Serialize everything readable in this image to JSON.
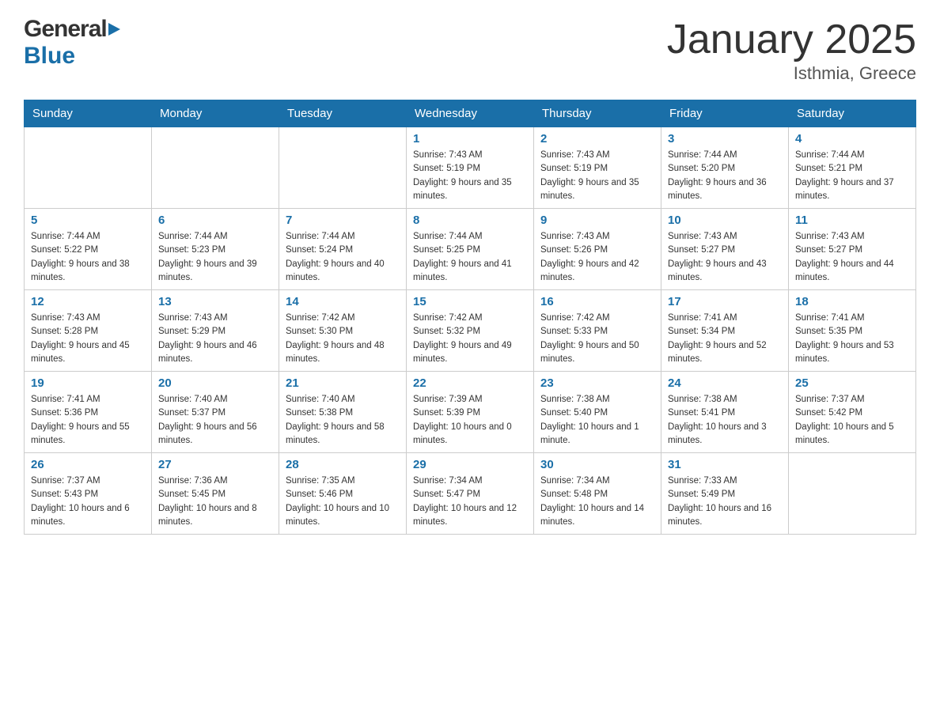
{
  "header": {
    "logo_general": "General",
    "logo_blue": "Blue",
    "title": "January 2025",
    "subtitle": "Isthmia, Greece"
  },
  "weekdays": [
    "Sunday",
    "Monday",
    "Tuesday",
    "Wednesday",
    "Thursday",
    "Friday",
    "Saturday"
  ],
  "weeks": [
    [
      {
        "day": "",
        "info": ""
      },
      {
        "day": "",
        "info": ""
      },
      {
        "day": "",
        "info": ""
      },
      {
        "day": "1",
        "info": "Sunrise: 7:43 AM\nSunset: 5:19 PM\nDaylight: 9 hours and 35 minutes."
      },
      {
        "day": "2",
        "info": "Sunrise: 7:43 AM\nSunset: 5:19 PM\nDaylight: 9 hours and 35 minutes."
      },
      {
        "day": "3",
        "info": "Sunrise: 7:44 AM\nSunset: 5:20 PM\nDaylight: 9 hours and 36 minutes."
      },
      {
        "day": "4",
        "info": "Sunrise: 7:44 AM\nSunset: 5:21 PM\nDaylight: 9 hours and 37 minutes."
      }
    ],
    [
      {
        "day": "5",
        "info": "Sunrise: 7:44 AM\nSunset: 5:22 PM\nDaylight: 9 hours and 38 minutes."
      },
      {
        "day": "6",
        "info": "Sunrise: 7:44 AM\nSunset: 5:23 PM\nDaylight: 9 hours and 39 minutes."
      },
      {
        "day": "7",
        "info": "Sunrise: 7:44 AM\nSunset: 5:24 PM\nDaylight: 9 hours and 40 minutes."
      },
      {
        "day": "8",
        "info": "Sunrise: 7:44 AM\nSunset: 5:25 PM\nDaylight: 9 hours and 41 minutes."
      },
      {
        "day": "9",
        "info": "Sunrise: 7:43 AM\nSunset: 5:26 PM\nDaylight: 9 hours and 42 minutes."
      },
      {
        "day": "10",
        "info": "Sunrise: 7:43 AM\nSunset: 5:27 PM\nDaylight: 9 hours and 43 minutes."
      },
      {
        "day": "11",
        "info": "Sunrise: 7:43 AM\nSunset: 5:27 PM\nDaylight: 9 hours and 44 minutes."
      }
    ],
    [
      {
        "day": "12",
        "info": "Sunrise: 7:43 AM\nSunset: 5:28 PM\nDaylight: 9 hours and 45 minutes."
      },
      {
        "day": "13",
        "info": "Sunrise: 7:43 AM\nSunset: 5:29 PM\nDaylight: 9 hours and 46 minutes."
      },
      {
        "day": "14",
        "info": "Sunrise: 7:42 AM\nSunset: 5:30 PM\nDaylight: 9 hours and 48 minutes."
      },
      {
        "day": "15",
        "info": "Sunrise: 7:42 AM\nSunset: 5:32 PM\nDaylight: 9 hours and 49 minutes."
      },
      {
        "day": "16",
        "info": "Sunrise: 7:42 AM\nSunset: 5:33 PM\nDaylight: 9 hours and 50 minutes."
      },
      {
        "day": "17",
        "info": "Sunrise: 7:41 AM\nSunset: 5:34 PM\nDaylight: 9 hours and 52 minutes."
      },
      {
        "day": "18",
        "info": "Sunrise: 7:41 AM\nSunset: 5:35 PM\nDaylight: 9 hours and 53 minutes."
      }
    ],
    [
      {
        "day": "19",
        "info": "Sunrise: 7:41 AM\nSunset: 5:36 PM\nDaylight: 9 hours and 55 minutes."
      },
      {
        "day": "20",
        "info": "Sunrise: 7:40 AM\nSunset: 5:37 PM\nDaylight: 9 hours and 56 minutes."
      },
      {
        "day": "21",
        "info": "Sunrise: 7:40 AM\nSunset: 5:38 PM\nDaylight: 9 hours and 58 minutes."
      },
      {
        "day": "22",
        "info": "Sunrise: 7:39 AM\nSunset: 5:39 PM\nDaylight: 10 hours and 0 minutes."
      },
      {
        "day": "23",
        "info": "Sunrise: 7:38 AM\nSunset: 5:40 PM\nDaylight: 10 hours and 1 minute."
      },
      {
        "day": "24",
        "info": "Sunrise: 7:38 AM\nSunset: 5:41 PM\nDaylight: 10 hours and 3 minutes."
      },
      {
        "day": "25",
        "info": "Sunrise: 7:37 AM\nSunset: 5:42 PM\nDaylight: 10 hours and 5 minutes."
      }
    ],
    [
      {
        "day": "26",
        "info": "Sunrise: 7:37 AM\nSunset: 5:43 PM\nDaylight: 10 hours and 6 minutes."
      },
      {
        "day": "27",
        "info": "Sunrise: 7:36 AM\nSunset: 5:45 PM\nDaylight: 10 hours and 8 minutes."
      },
      {
        "day": "28",
        "info": "Sunrise: 7:35 AM\nSunset: 5:46 PM\nDaylight: 10 hours and 10 minutes."
      },
      {
        "day": "29",
        "info": "Sunrise: 7:34 AM\nSunset: 5:47 PM\nDaylight: 10 hours and 12 minutes."
      },
      {
        "day": "30",
        "info": "Sunrise: 7:34 AM\nSunset: 5:48 PM\nDaylight: 10 hours and 14 minutes."
      },
      {
        "day": "31",
        "info": "Sunrise: 7:33 AM\nSunset: 5:49 PM\nDaylight: 10 hours and 16 minutes."
      },
      {
        "day": "",
        "info": ""
      }
    ]
  ]
}
